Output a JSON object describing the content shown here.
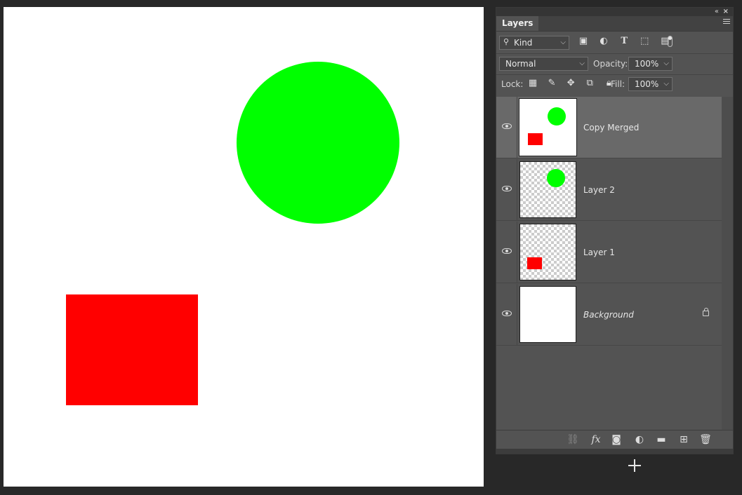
{
  "panel": {
    "tab": "Layers",
    "filter": {
      "kind": "Kind"
    },
    "blend_mode": "Normal",
    "opacity_label": "Opacity:",
    "opacity": "100%",
    "lock_label": "Lock:",
    "fill_label": "Fill:",
    "fill": "100%"
  },
  "layers": [
    {
      "name": "Copy Merged",
      "selected": true,
      "visible": true,
      "locked": false,
      "italic": false
    },
    {
      "name": "Layer 2",
      "selected": false,
      "visible": true,
      "locked": false,
      "italic": false
    },
    {
      "name": "Layer 1",
      "selected": false,
      "visible": true,
      "locked": false,
      "italic": false
    },
    {
      "name": "Background",
      "selected": false,
      "visible": true,
      "locked": true,
      "italic": true
    }
  ],
  "colors": {
    "green_circle": "#00ff00",
    "red_rectangle": "#ff0000",
    "panel_bg": "#535353",
    "selected_row": "#696969",
    "app_bg": "#282828"
  },
  "icons": {
    "filter_icons": [
      "image-filter-icon",
      "adjustment-filter-icon",
      "type-filter-icon",
      "shape-filter-icon",
      "smart-object-filter-icon"
    ],
    "lock_icons": [
      "lock-transparent-pixels-icon",
      "lock-image-pixels-icon",
      "lock-position-icon",
      "lock-artboard-icon",
      "lock-all-icon"
    ],
    "bottom_icons": [
      "link-layers-icon",
      "fx-icon",
      "add-mask-icon",
      "adjustment-layer-icon",
      "new-group-icon",
      "new-layer-icon",
      "delete-layer-icon"
    ]
  }
}
